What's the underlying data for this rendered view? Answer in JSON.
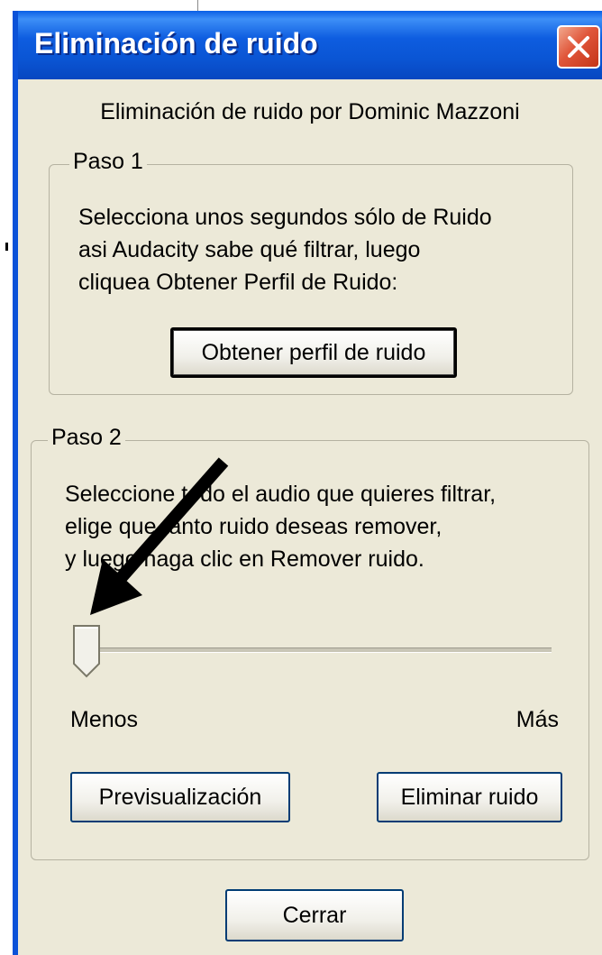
{
  "window": {
    "title": "Eliminación de ruido",
    "close_icon": "close-x-icon"
  },
  "author": "Eliminación de ruido por Dominic Mazzoni",
  "step1": {
    "legend": "Paso 1",
    "lines": [
      "Selecciona unos segundos sólo de Ruido",
      "asi Audacity sabe qué filtrar, luego",
      "cliquea Obtener Perfil de Ruido:"
    ],
    "button": "Obtener perfil de ruido"
  },
  "step2": {
    "legend": "Paso 2",
    "lines": [
      "Seleccione todo el audio que quieres filtrar,",
      "elige que tanto ruido deseas remover,",
      "y luego haga clic en Remover ruido."
    ],
    "slider": {
      "min_label": "Menos",
      "max_label": "Más",
      "value": 0.0
    },
    "preview_button": "Previsualización",
    "remove_button": "Eliminar ruido"
  },
  "close_button": "Cerrar",
  "colors": {
    "titlebar": "#0a55d4",
    "dialog_bg": "#ece9d8",
    "close_red": "#e0563a",
    "annotation_arrow": "#000000"
  }
}
